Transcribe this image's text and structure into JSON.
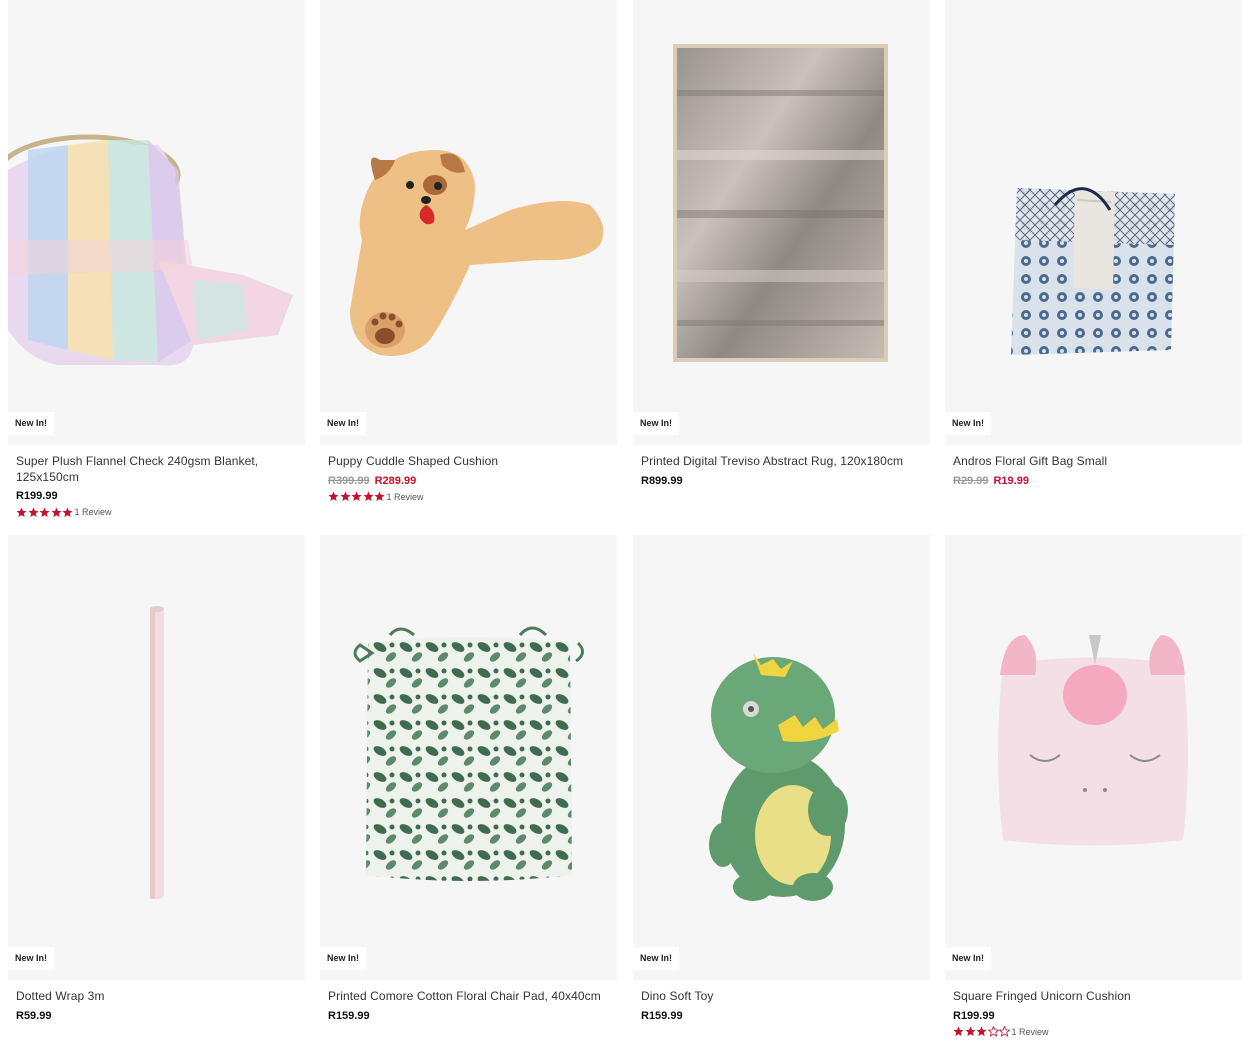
{
  "products": [
    {
      "badge": "New In!",
      "title": "Super Plush Flannel Check 240gsm Blanket, 125x150cm",
      "price": "R199.99",
      "rating": 5,
      "reviews": "1 Review",
      "image": "pastel check blanket draped over basket"
    },
    {
      "badge": "New In!",
      "title": "Puppy Cuddle Shaped Cushion",
      "was": "R399.99",
      "now": "R289.99",
      "rating": 5,
      "reviews": "1 Review",
      "image": "tan puppy shaped cushion"
    },
    {
      "badge": "New In!",
      "title": "Printed Digital Treviso Abstract Rug, 120x180cm",
      "price": "R899.99",
      "image": "grey abstract rug"
    },
    {
      "badge": "New In!",
      "title": "Andros Floral Gift Bag Small",
      "was": "R29.99",
      "now": "R19.99",
      "image": "blue floral gift bag"
    },
    {
      "badge": "New In!",
      "title": "Dotted Wrap 3m",
      "price": "R59.99",
      "image": "pink dotted wrap roll"
    },
    {
      "badge": "New In!",
      "title": "Printed Comore Cotton Floral Chair Pad, 40x40cm",
      "price": "R159.99",
      "image": "green floral chair pad"
    },
    {
      "badge": "New In!",
      "title": "Dino Soft Toy",
      "price": "R159.99",
      "image": "green dinosaur plush"
    },
    {
      "badge": "New In!",
      "title": "Square Fringed Unicorn Cushion",
      "price": "R199.99",
      "rating": 3,
      "reviews": "1 Review",
      "image": "pink unicorn cushion"
    }
  ],
  "colors": {
    "sale": "#c8102e",
    "star": "#c8102e",
    "tile_bg": "#f6f6f6"
  }
}
